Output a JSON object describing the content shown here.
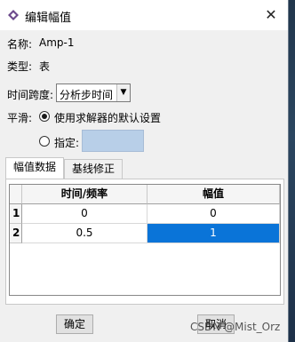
{
  "window": {
    "title": "编辑幅值",
    "close_label": "✕"
  },
  "info": {
    "name_label": "名称:",
    "name_value": "Amp-1",
    "type_label": "类型:",
    "type_value": "表"
  },
  "time_span": {
    "label": "时间跨度:",
    "selected": "分析步时间"
  },
  "smoothing": {
    "label": "平滑:",
    "option_default": "使用求解器的默认设置",
    "option_specify": "指定:",
    "specify_value": ""
  },
  "tabs": [
    {
      "label": "幅值数据",
      "active": true
    },
    {
      "label": "基线修正",
      "active": false
    }
  ],
  "table": {
    "headers": [
      "时间/频率",
      "幅值"
    ],
    "rows": [
      {
        "index": "1",
        "time": "0",
        "amplitude": "0"
      },
      {
        "index": "2",
        "time": "0.5",
        "amplitude": "1"
      }
    ]
  },
  "buttons": {
    "ok": "确定",
    "cancel": "取消"
  },
  "watermark": "CSDN @Mist_Orz",
  "colors": {
    "selection": "#0a74d8",
    "input_highlight": "#b8cfe8"
  }
}
